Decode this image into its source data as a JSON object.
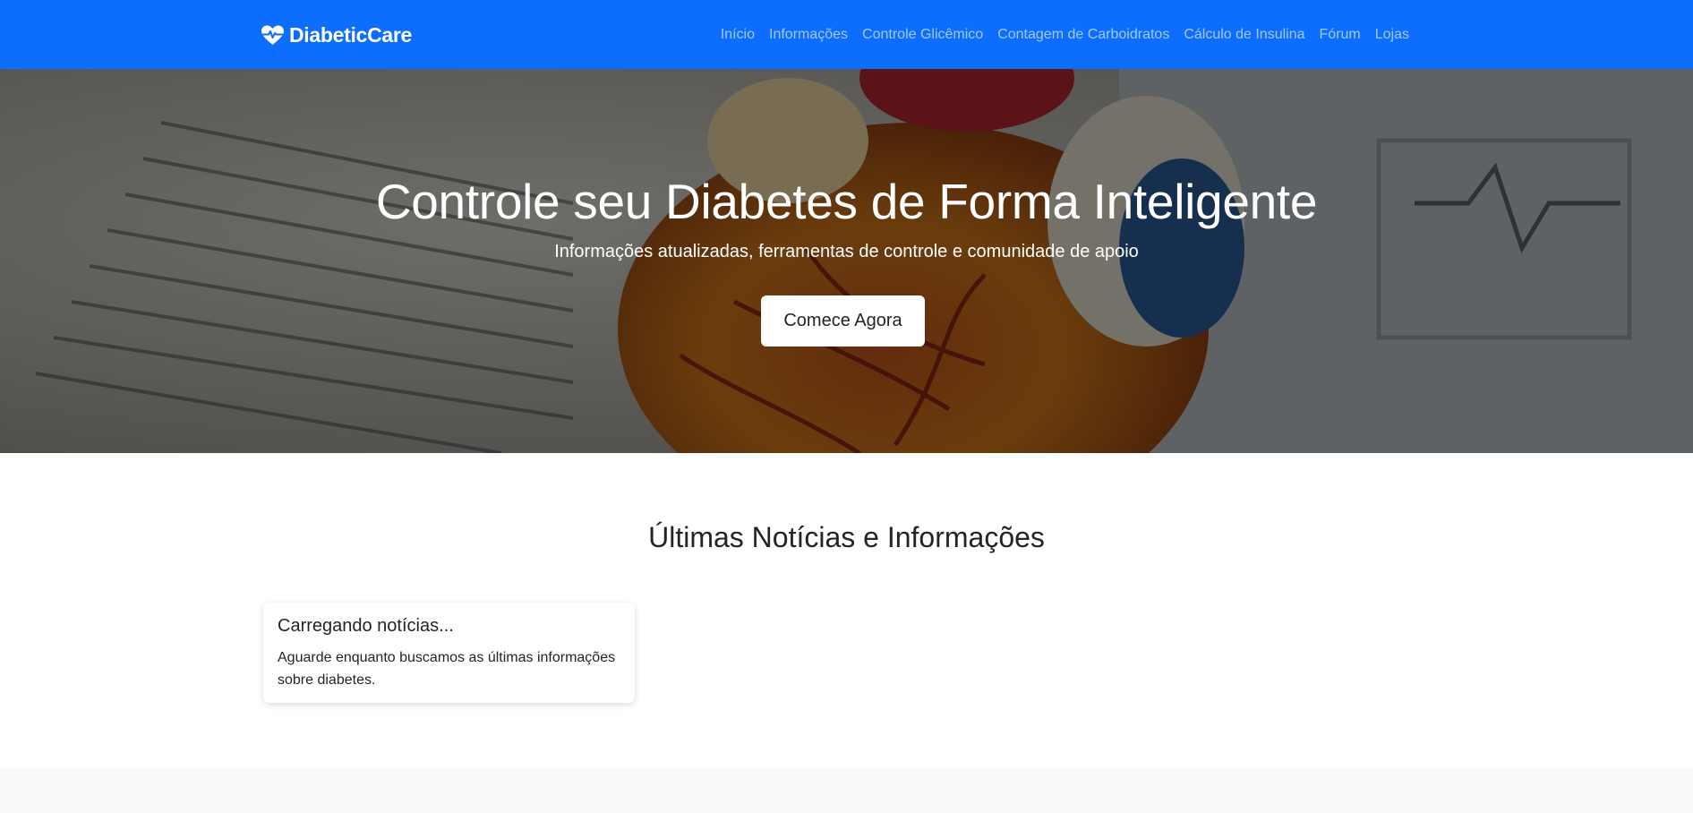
{
  "navbar": {
    "brand": "DiabeticCare",
    "brand_icon": "heart-pulse-icon",
    "links": [
      "Início",
      "Informações",
      "Controle Glicêmico",
      "Contagem de Carboidratos",
      "Cálculo de Insulina",
      "Fórum",
      "Lojas"
    ],
    "background": "#0d6efd"
  },
  "hero": {
    "title": "Controle seu Diabetes de Forma Inteligente",
    "subtitle": "Informações atualizadas, ferramentas de controle e comunidade de apoio",
    "cta_label": "Comece Agora"
  },
  "news": {
    "section_title": "Últimas Notícias e Informações",
    "cards": [
      {
        "title": "Carregando notícias...",
        "text": "Aguarde enquanto buscamos as últimas informações sobre diabetes."
      }
    ]
  }
}
